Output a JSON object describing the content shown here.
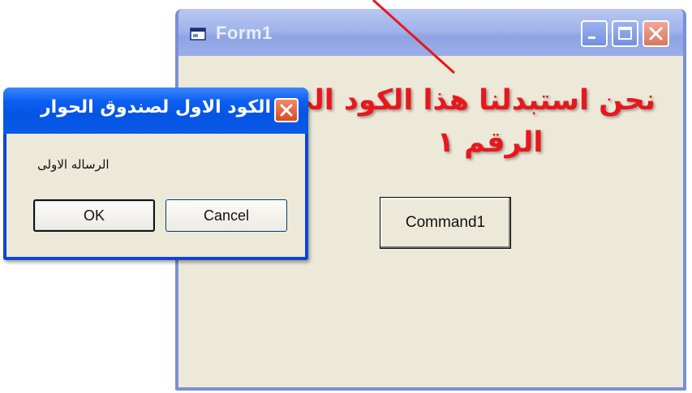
{
  "main_window": {
    "title": "Form1",
    "command_button_label": "Command1"
  },
  "annotation": {
    "line1": "نحن استبدلنا  هذا الكود الى",
    "line2": "الرقم ١",
    "color": "#e8171d"
  },
  "dialog": {
    "title": "الكود الاول لصندوق الحوار",
    "message": "الرساله الاولى",
    "ok_label": "OK",
    "cancel_label": "Cancel",
    "titlebar_color": "#0a5ae8"
  },
  "icons": [
    "window-app-icon",
    "minimize-icon",
    "maximize-icon",
    "close-icon",
    "red-arrow"
  ]
}
